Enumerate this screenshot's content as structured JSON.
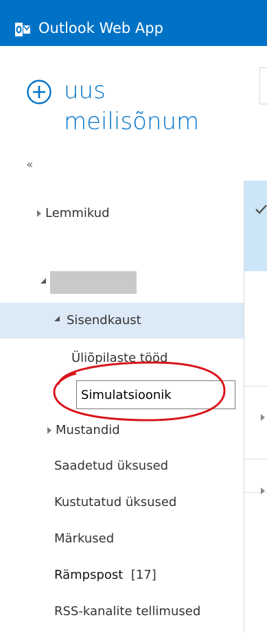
{
  "header": {
    "app_title": "Outlook Web App",
    "bg_color": "#0072c6",
    "logo_icon": "outlook-logo-icon"
  },
  "new_mail": {
    "line1": "uus",
    "line2": "meilisõnum",
    "icon": "plus-circle-icon",
    "color": "#0072c6"
  },
  "collapse_label": "«",
  "folders": {
    "favorites": "Lemmikud",
    "account_name": "",
    "inbox": "Sisendkaust",
    "student_works": "Üliõpilaste tööd",
    "rename_value": "Simulatsioonik",
    "drafts": "Mustandid",
    "sent": "Saadetud üksused",
    "deleted": "Kustutatud üksused",
    "notes": "Märkused",
    "junk": "Rämpspost",
    "junk_count": "[17]",
    "rss": "RSS-kanalite tellimused"
  },
  "colors": {
    "selected_folder_bg": "#dce9f6",
    "selected_message_bg": "#cde6f7",
    "annotation_red": "#d9141b"
  }
}
